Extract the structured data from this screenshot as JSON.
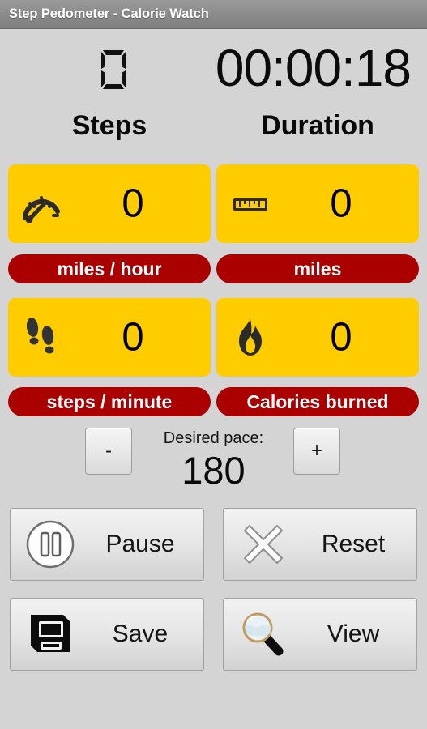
{
  "window": {
    "title": "Step Pedometer - Calorie Watch"
  },
  "colors": {
    "accent_yellow": "#FFCC00",
    "accent_red": "#AA0000",
    "background": "#D4D4D4",
    "titlebar": "#8D8D8D"
  },
  "header": {
    "segment_digit_icon": "seven-segment-zero-icon",
    "segment_digit_value": "0",
    "timer": "00:00:18"
  },
  "columns": {
    "left_heading": "Steps",
    "right_heading": "Duration"
  },
  "metrics": [
    {
      "icon": "speedometer-icon",
      "value": "0",
      "unit": "miles / hour"
    },
    {
      "icon": "ruler-icon",
      "value": "0",
      "unit": "miles"
    },
    {
      "icon": "footprints-icon",
      "value": "0",
      "unit": "steps / minute"
    },
    {
      "icon": "flame-icon",
      "value": "0",
      "unit": "Calories burned"
    }
  ],
  "pace": {
    "label": "Desired pace:",
    "value": "180",
    "decrement_label": "-",
    "increment_label": "+"
  },
  "actions": [
    {
      "icon": "pause-circle-icon",
      "label": "Pause"
    },
    {
      "icon": "close-x-icon",
      "label": "Reset"
    },
    {
      "icon": "floppy-disk-icon",
      "label": "Save"
    },
    {
      "icon": "magnifier-icon",
      "label": "View"
    }
  ]
}
